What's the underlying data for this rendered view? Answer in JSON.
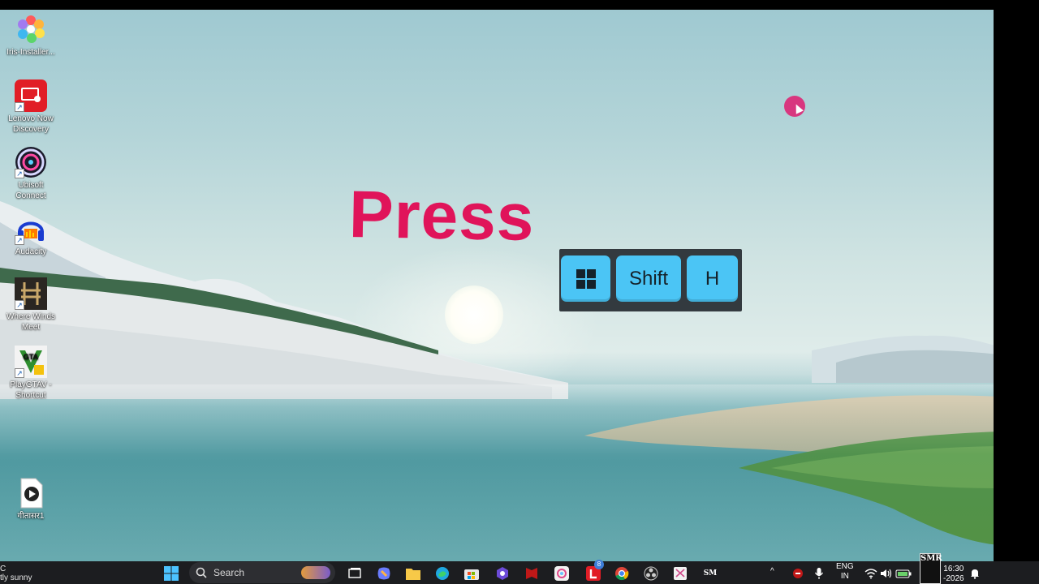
{
  "overlay": {
    "press_text": "Press",
    "keys": [
      {
        "label": "",
        "icon": "windows-logo-icon"
      },
      {
        "label": "Shift"
      },
      {
        "label": "H"
      }
    ]
  },
  "desktop_icons": [
    {
      "label": "Iris-Installer...",
      "icon": "iris-installer-icon"
    },
    {
      "label": "Lenovo Now Discovery",
      "icon": "lenovo-now-icon"
    },
    {
      "label": "Ubisoft Connect",
      "icon": "ubisoft-connect-icon"
    },
    {
      "label": "Audacity",
      "icon": "audacity-icon"
    },
    {
      "label": "Where Winds Meet",
      "icon": "where-winds-meet-icon"
    },
    {
      "label": "PlayGTAV - Shortcut",
      "icon": "gtav-icon"
    },
    {
      "label": "गीतासर1",
      "icon": "media-file-icon"
    }
  ],
  "taskbar": {
    "weather_line1": "C",
    "weather_line2": "tly sunny",
    "search_placeholder": "Search",
    "badge_count": "8",
    "language_top": "ENG",
    "language_bottom": "IN",
    "time": "16:30",
    "date": "-2026",
    "watermark": "SMR"
  },
  "colors": {
    "press": "#e0145a",
    "key_bg": "#4bc5f5",
    "taskbar_bg": "#1c1d20"
  }
}
